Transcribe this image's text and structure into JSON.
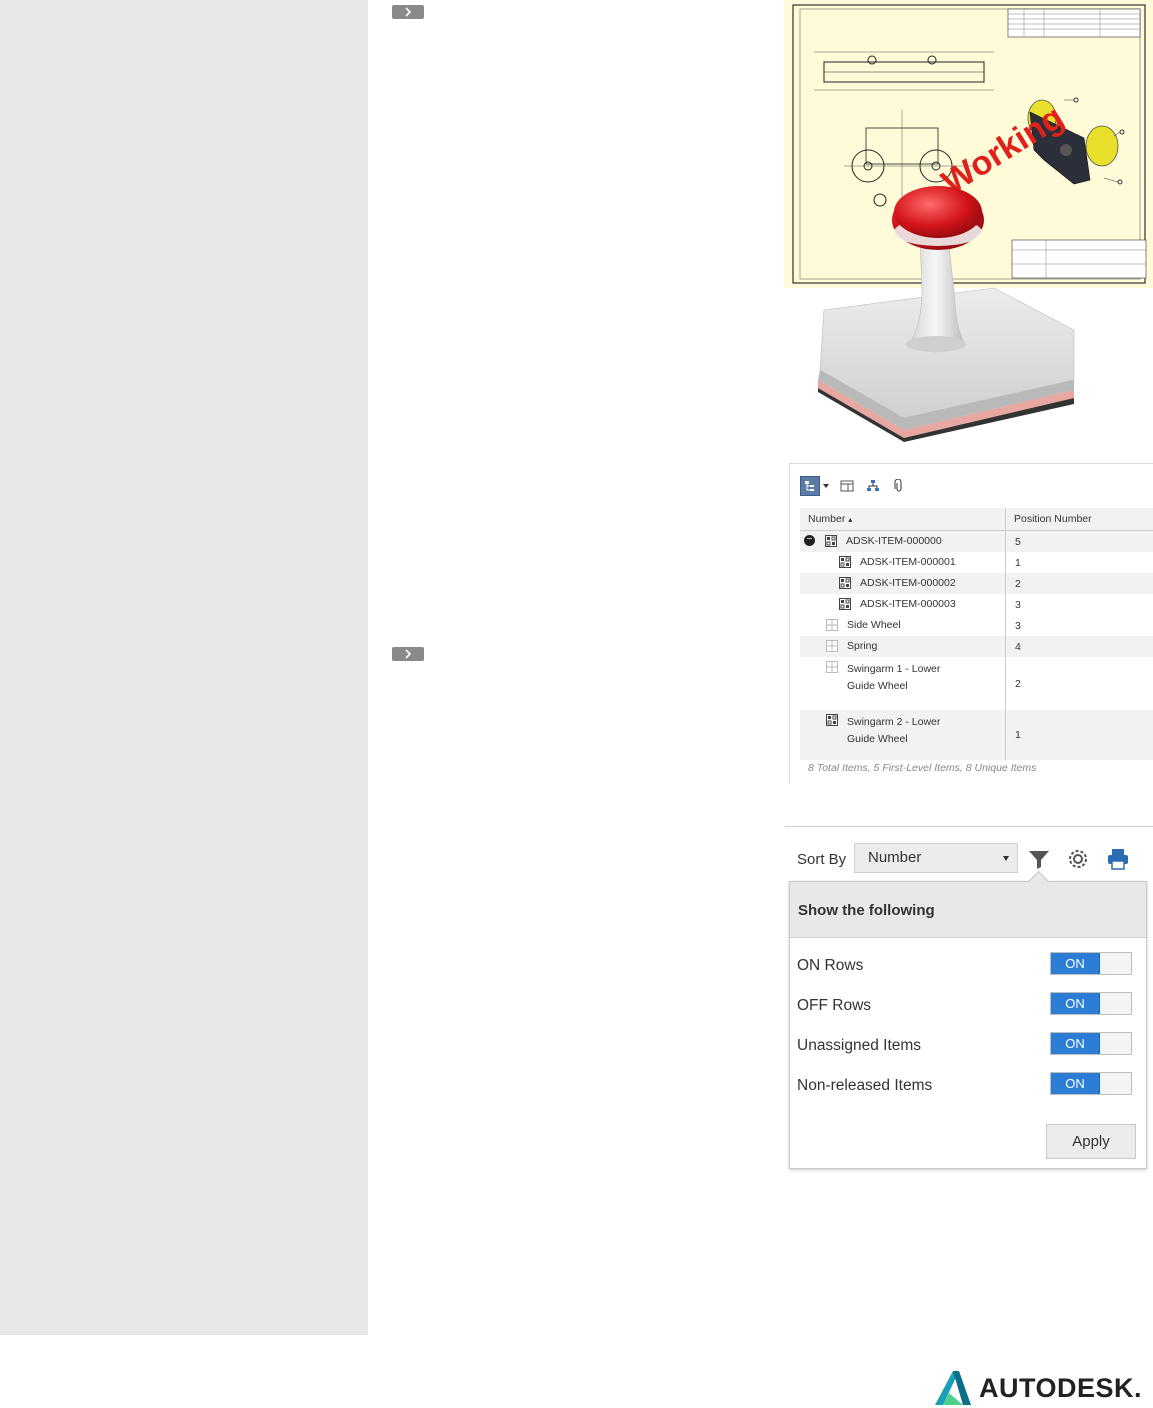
{
  "drawing": {
    "stamp_text": "Working"
  },
  "bom": {
    "columns": [
      "Number",
      "Position Number"
    ],
    "sort_indicator": "▴",
    "rows": [
      {
        "label": "ADSK-ITEM-000000",
        "pos": "5"
      },
      {
        "label": "ADSK-ITEM-000001",
        "pos": "1"
      },
      {
        "label": "ADSK-ITEM-000002",
        "pos": "2"
      },
      {
        "label": "ADSK-ITEM-000003",
        "pos": "3"
      },
      {
        "label": "Side Wheel",
        "pos": "3"
      },
      {
        "label": "Spring",
        "pos": "4"
      },
      {
        "label": "Swingarm 1 - Lower Guide Wheel",
        "pos": "2"
      },
      {
        "label": "Swingarm 2 - Lower Guide Wheel",
        "pos": "1"
      }
    ],
    "footer": "8 Total Items, 5 First-Level Items, 8 Unique Items"
  },
  "filter": {
    "sort_by_label": "Sort By",
    "sort_value": "Number",
    "popup_title": "Show the following",
    "options": [
      {
        "label": "ON Rows",
        "state": "ON"
      },
      {
        "label": "OFF Rows",
        "state": "ON"
      },
      {
        "label": "Unassigned Items",
        "state": "ON"
      },
      {
        "label": "Non-released Items",
        "state": "ON"
      }
    ],
    "apply_label": "Apply"
  },
  "logo": {
    "text": "AUTODESK."
  }
}
